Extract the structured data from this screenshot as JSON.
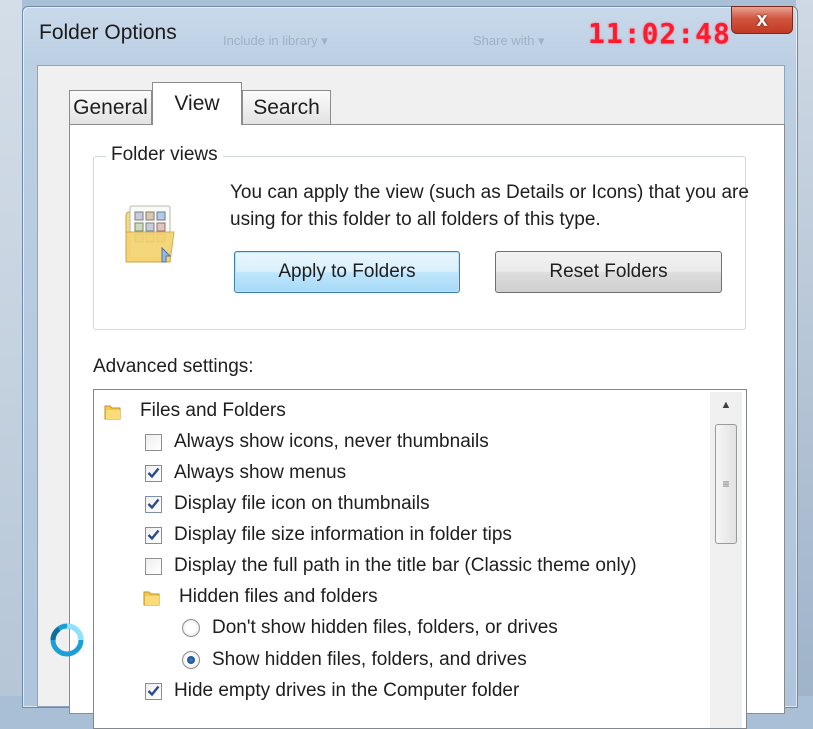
{
  "window": {
    "title": "Folder Options",
    "ghost_text_1": "Include in library ▾",
    "ghost_text_2": "Share with ▾",
    "clock_text": "11:02:48",
    "close_label": "x"
  },
  "tabs": [
    {
      "label": "General",
      "active": false
    },
    {
      "label": "View",
      "active": true
    },
    {
      "label": "Search",
      "active": false
    }
  ],
  "folder_views": {
    "legend": "Folder views",
    "description": "You can apply the view (such as Details or Icons) that you are using for this folder to all folders of this type.",
    "apply_label": "Apply to Folders",
    "reset_label": "Reset Folders"
  },
  "advanced": {
    "label": "Advanced settings:",
    "items": [
      {
        "type": "folder",
        "label": "Files and Folders"
      },
      {
        "type": "checkbox",
        "label": "Always show icons, never thumbnails",
        "checked": false
      },
      {
        "type": "checkbox",
        "label": "Always show menus",
        "checked": true
      },
      {
        "type": "checkbox",
        "label": "Display file icon on thumbnails",
        "checked": true
      },
      {
        "type": "checkbox",
        "label": "Display file size information in folder tips",
        "checked": true
      },
      {
        "type": "checkbox",
        "label": "Display the full path in the title bar (Classic theme only)",
        "checked": false
      },
      {
        "type": "folder",
        "label": "Hidden files and folders"
      },
      {
        "type": "radio",
        "label": "Don't show hidden files, folders, or drives",
        "checked": false
      },
      {
        "type": "radio",
        "label": "Show hidden files, folders, and drives",
        "checked": true
      },
      {
        "type": "checkbox",
        "label": "Hide empty drives in the Computer folder",
        "checked": true
      }
    ]
  },
  "colors": {
    "clock": "#ff1a2e",
    "close_button": "#c23a22",
    "apply_border": "#3c7fb1"
  }
}
